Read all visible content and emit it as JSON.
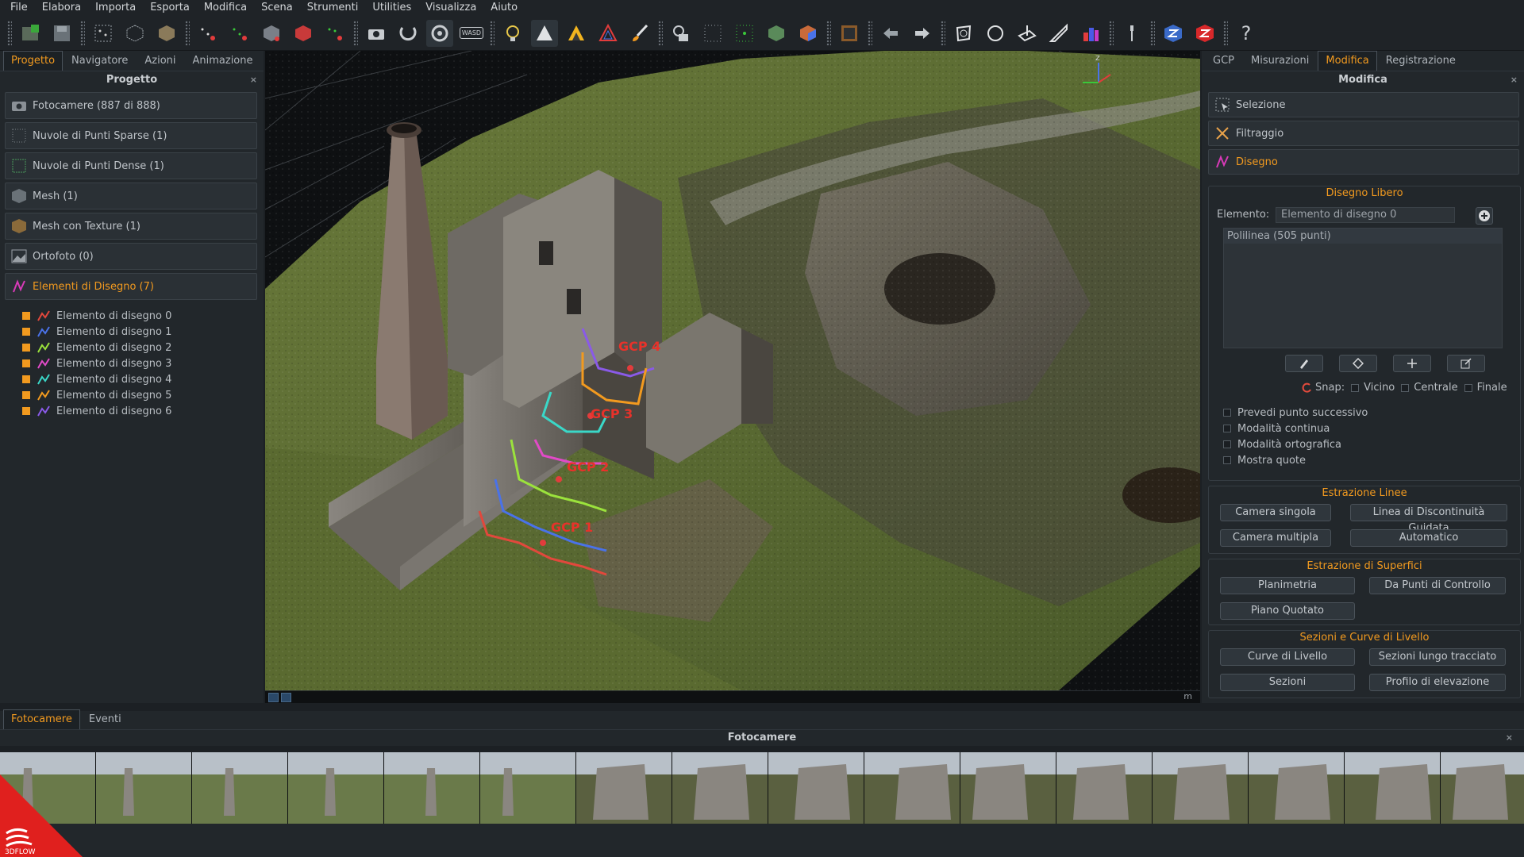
{
  "menu": [
    "File",
    "Elabora",
    "Importa",
    "Esporta",
    "Modifica",
    "Scena",
    "Strumenti",
    "Utilities",
    "Visualizza",
    "Aiuto"
  ],
  "toolbar": {
    "wasd_label": "WASD",
    "help_label": "?",
    "icons": [
      "new-project-icon",
      "save-icon",
      "sparse-cloud-icon",
      "dense-cloud-icon",
      "mesh-icon",
      "textured-mesh-icon",
      "points-select-icon",
      "points-deselect-icon",
      "mesh-red-icon",
      "texture-red-icon",
      "points-green-icon",
      "camera-icon",
      "rotate-icon",
      "orbit-icon",
      "wasd-icon",
      "lightbulb-icon",
      "triangle-icon",
      "triangle-color-icon",
      "triangle-outline-icon",
      "brush-icon",
      "camera-gear-icon",
      "dots-icon",
      "dots-green-icon",
      "cube-icon",
      "cube-color-icon",
      "frame-icon",
      "undo-icon",
      "redo-icon",
      "lasso-icon",
      "circle-select-icon",
      "plane-icon",
      "ruler-icon",
      "chart-icon",
      "wrench-icon",
      "zephyr-cube-icon",
      "zephyr-red-icon",
      "help-icon"
    ]
  },
  "left": {
    "tabs": [
      "Progetto",
      "Navigatore",
      "Azioni",
      "Animazione"
    ],
    "title": "Progetto",
    "close": "×",
    "categories": [
      {
        "label": "Fotocamere (887 di 888)",
        "icon": "camera-icon"
      },
      {
        "label": "Nuvole di Punti Sparse (1)",
        "icon": "sparse-cloud-icon"
      },
      {
        "label": "Nuvole di Punti Dense (1)",
        "icon": "dense-cloud-icon"
      },
      {
        "label": "Mesh (1)",
        "icon": "mesh-icon"
      },
      {
        "label": "Mesh con Texture (1)",
        "icon": "textured-mesh-icon"
      },
      {
        "label": "Ortofoto (0)",
        "icon": "orthophoto-icon"
      },
      {
        "label": "Elementi di Disegno (7)",
        "icon": "drawing-icon"
      }
    ],
    "elements": [
      {
        "label": "Elemento di disegno 0",
        "color": "#e2483c"
      },
      {
        "label": "Elemento di disegno 1",
        "color": "#4a72e8"
      },
      {
        "label": "Elemento di disegno 2",
        "color": "#9be23c"
      },
      {
        "label": "Elemento di disegno 3",
        "color": "#e24ac8"
      },
      {
        "label": "Elemento di disegno 4",
        "color": "#3ad8c8"
      },
      {
        "label": "Elemento di disegno 5",
        "color": "#f29a1f"
      },
      {
        "label": "Elemento di disegno 6",
        "color": "#8a5ae8"
      }
    ]
  },
  "viewport": {
    "gcp_labels": [
      "GCP 4",
      "GCP 3",
      "GCP 2",
      "GCP 1"
    ],
    "axis_label": "z",
    "unit": "m"
  },
  "right": {
    "tabs": [
      "GCP",
      "Misurazioni",
      "Modifica",
      "Registrazione"
    ],
    "title": "Modifica",
    "close": "×",
    "sections": [
      {
        "label": "Selezione",
        "icon": "selection-icon"
      },
      {
        "label": "Filtraggio",
        "icon": "filter-icon"
      },
      {
        "label": "Disegno",
        "icon": "drawing-icon"
      }
    ],
    "free_draw": {
      "title": "Disegno Libero",
      "element_label": "Elemento:",
      "element_value": "Elemento di disegno 0",
      "list_item": "Polilinea (505 punti)",
      "snap_label": "Snap:",
      "snap_options": [
        "Vicino",
        "Centrale",
        "Finale"
      ],
      "checks": [
        "Prevedi punto successivo",
        "Modalità continua",
        "Modalità ortografica",
        "Mostra quote"
      ]
    },
    "lines": {
      "title": "Estrazione Linee",
      "buttons": [
        "Camera singola",
        "Linea di Discontinuità Guidata",
        "Camera multipla",
        "Automatico"
      ]
    },
    "surfaces": {
      "title": "Estrazione di Superfici",
      "buttons": [
        "Planimetria",
        "Da Punti di Controllo",
        "Piano Quotato"
      ]
    },
    "sections_curves": {
      "title": "Sezioni e Curve di Livello",
      "buttons": [
        "Curve di Livello",
        "Sezioni lungo tracciato",
        "Sezioni",
        "Profilo di elevazione"
      ]
    }
  },
  "bottom": {
    "tabs": [
      "Fotocamere",
      "Eventi"
    ],
    "title": "Fotocamere",
    "close": "×",
    "logo_text": "3DFLOW"
  }
}
